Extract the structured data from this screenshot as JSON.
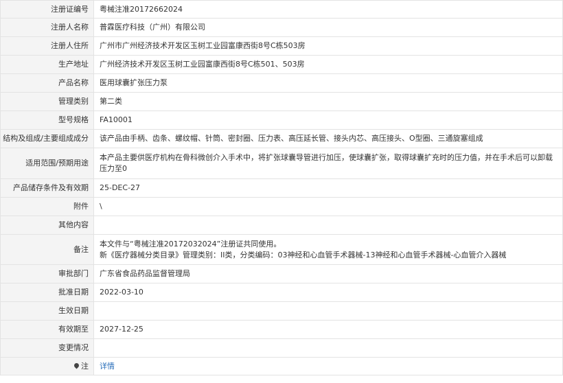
{
  "rows": [
    {
      "label": "注册证编号",
      "value": "粤械注准20172662024"
    },
    {
      "label": "注册人名称",
      "value": "普霖医疗科技（广州）有限公司"
    },
    {
      "label": "注册人住所",
      "value": "广州市广州经济技术开发区玉树工业园富康西街8号C栋503房"
    },
    {
      "label": "生产地址",
      "value": "广州经济技术开发区玉树工业园富康西街8号C栋501、503房"
    },
    {
      "label": "产品名称",
      "value": "医用球囊扩张压力泵"
    },
    {
      "label": "管理类别",
      "value": "第二类"
    },
    {
      "label": "型号规格",
      "value": "FA10001"
    },
    {
      "label": "结构及组成/主要组成成分",
      "value": "该产品由手柄、齿条、螺纹帽、针筒、密封圈、压力表、高压延长管、接头内芯、高压接头、O型圈、三通旋塞组成"
    },
    {
      "label": "适用范围/预期用途",
      "value": "本产品主要供医疗机构在骨科微创介入手术中，将扩张球囊导管进行加压，使球囊扩张，取得球囊扩充时的压力值，并在手术后可以卸载压力至0"
    },
    {
      "label": "产品储存条件及有效期",
      "value": "25-DEC-27"
    },
    {
      "label": "附件",
      "value": "\\"
    },
    {
      "label": "其他内容",
      "value": ""
    },
    {
      "label": "备注",
      "value_line1": "本文件与“粤械注准20172032024”注册证共同使用。",
      "value_line2": "新《医疗器械分类目录》管理类别：II类，分类编码：03神经和心血管手术器械-13神经和心血管手术器械-心血管介入器械"
    },
    {
      "label": "审批部门",
      "value": "广东省食品药品监督管理局"
    },
    {
      "label": "批准日期",
      "value": "2022-03-10"
    },
    {
      "label": "生效日期",
      "value": ""
    },
    {
      "label": "有效期至",
      "value": "2027-12-25"
    },
    {
      "label": "变更情况",
      "value": ""
    },
    {
      "label": "注",
      "value": "详情",
      "icon": "pin-icon"
    }
  ]
}
